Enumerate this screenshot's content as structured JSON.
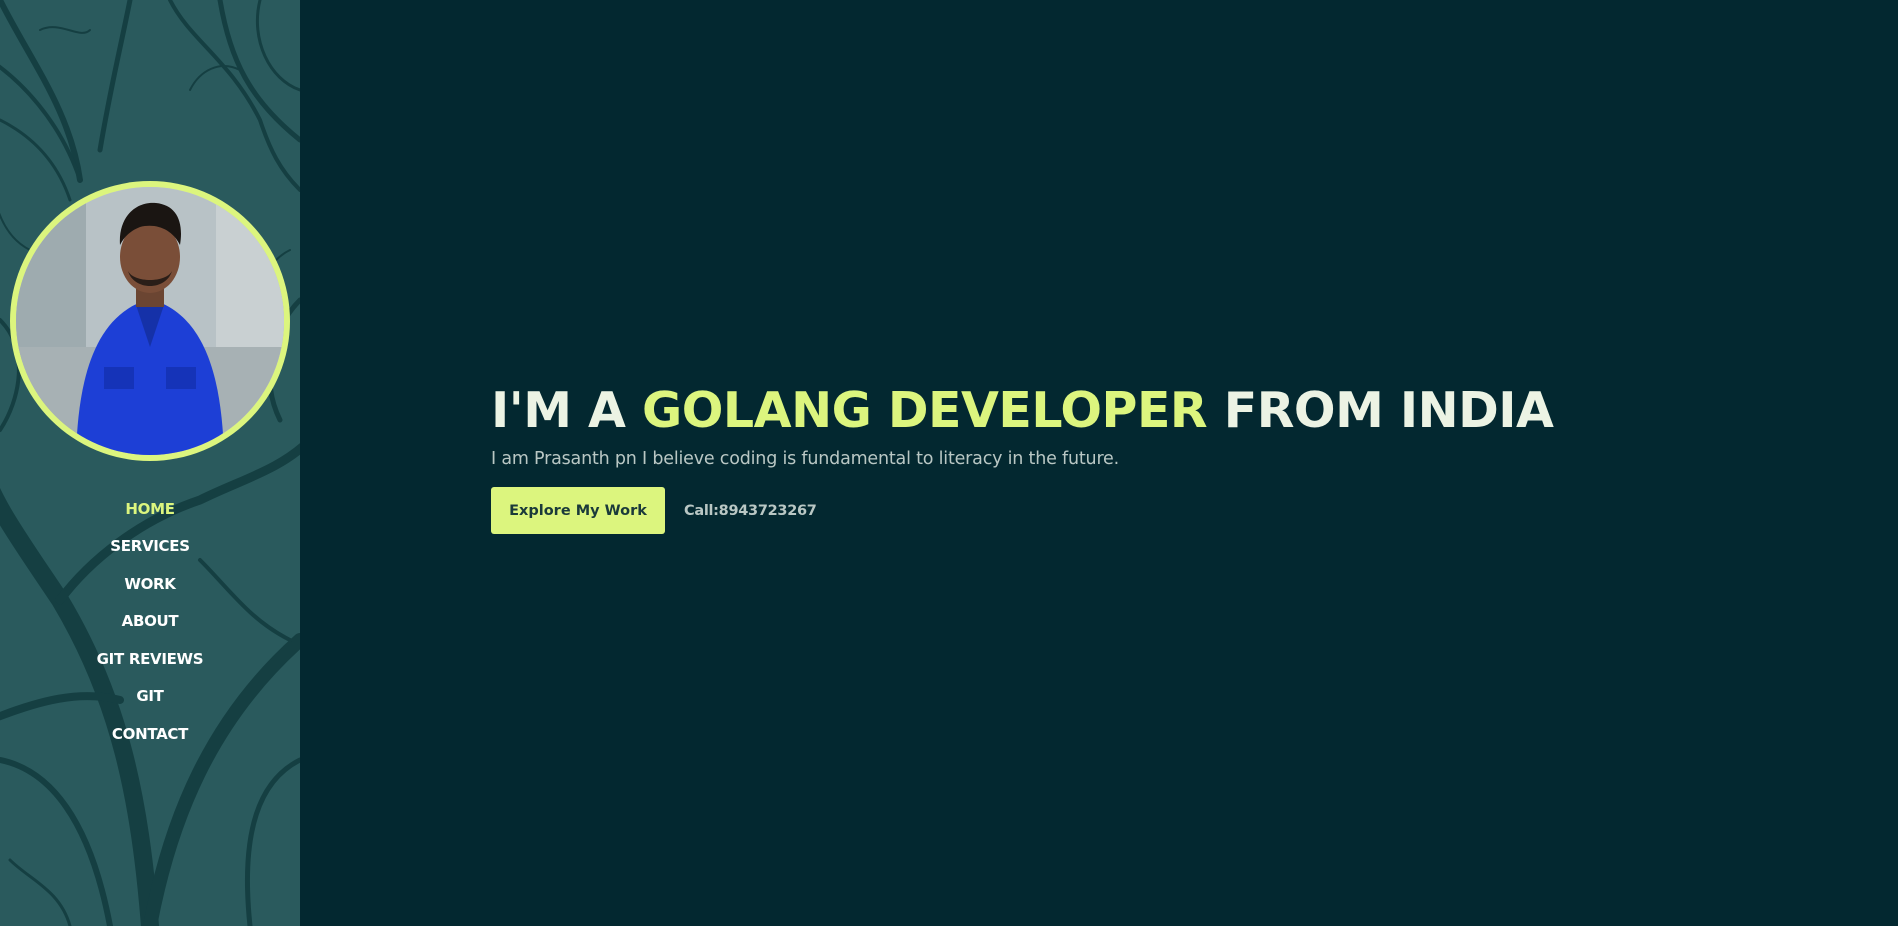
{
  "sidebar": {
    "avatar_alt": "Profile photo",
    "nav": [
      {
        "label": "HOME",
        "active": true
      },
      {
        "label": "SERVICES",
        "active": false
      },
      {
        "label": "WORK",
        "active": false
      },
      {
        "label": "ABOUT",
        "active": false
      },
      {
        "label": "GIT REVIEWS",
        "active": false
      },
      {
        "label": "GIT",
        "active": false
      },
      {
        "label": "CONTACT",
        "active": false
      }
    ]
  },
  "hero": {
    "headline_prefix": "I'M A ",
    "headline_accent": "GOLANG DEVELOPER",
    "headline_suffix": " FROM INDIA",
    "tagline": "I am Prasanth pn I believe coding is fundamental to literacy in the future.",
    "cta_label": "Explore My Work",
    "call_label": "Call:8943723267"
  },
  "colors": {
    "background": "#032830",
    "sidebar": "#2a5a5d",
    "accent": "#dcf57e",
    "text_light": "#ecf3e4",
    "text_muted": "#b9c7c4"
  }
}
